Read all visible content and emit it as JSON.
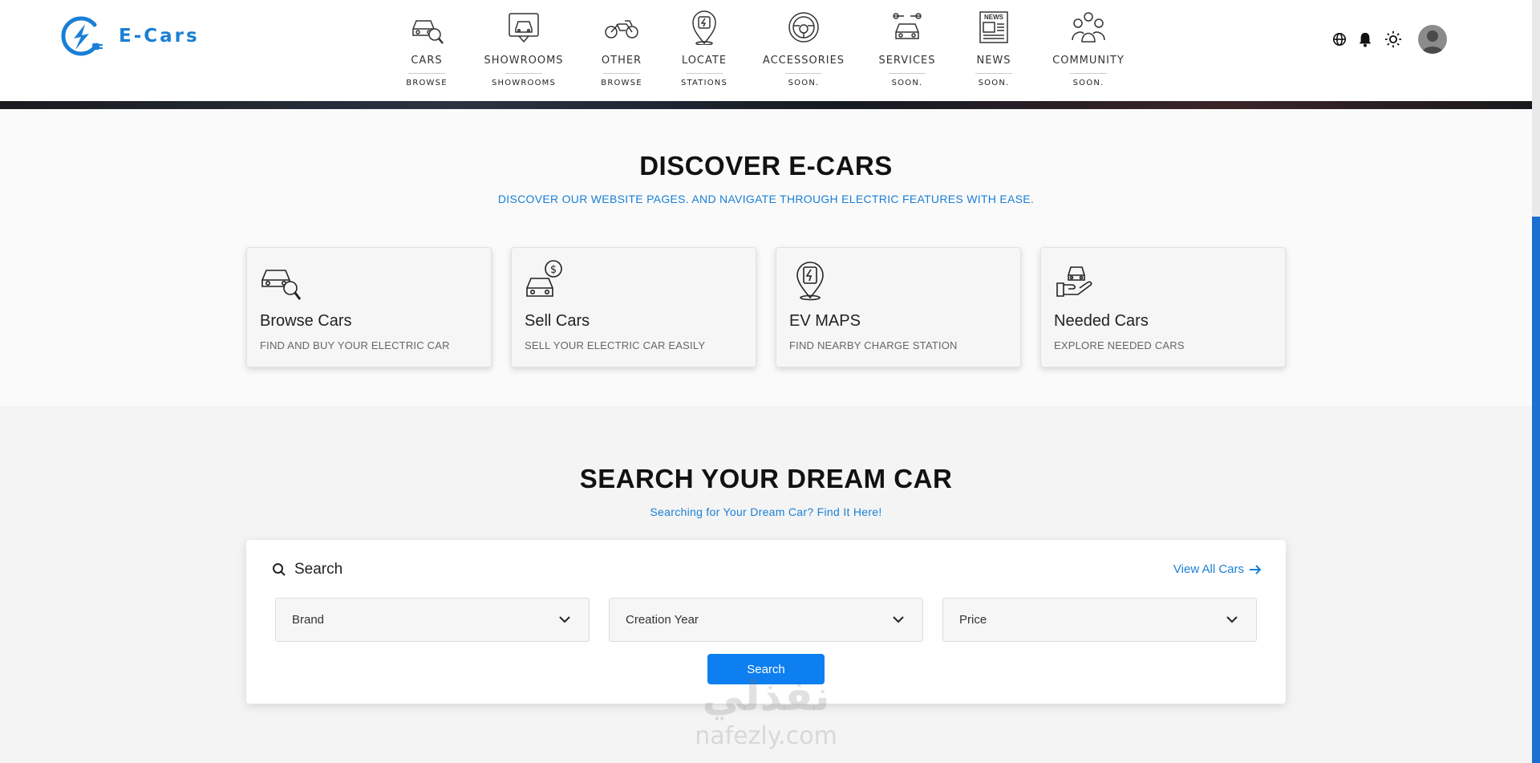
{
  "brand": {
    "name": "E-Cars",
    "color": "#1a7fd6"
  },
  "nav": [
    {
      "label": "CARS",
      "sub": "BROWSE",
      "icon": "car-search-icon"
    },
    {
      "label": "SHOWROOMS",
      "sub": "SHOWROOMS",
      "icon": "showroom-icon"
    },
    {
      "label": "OTHER",
      "sub": "BROWSE",
      "icon": "motorcycle-icon"
    },
    {
      "label": "LOCATE",
      "sub": "STATIONS",
      "icon": "location-pin-icon"
    },
    {
      "label": "ACCESSORIES",
      "sub": "SOON.",
      "icon": "steering-wheel-icon"
    },
    {
      "label": "SERVICES",
      "sub": "SOON.",
      "icon": "car-service-icon"
    },
    {
      "label": "NEWS",
      "sub": "SOON.",
      "icon": "newspaper-icon"
    },
    {
      "label": "COMMUNITY",
      "sub": "SOON.",
      "icon": "community-icon"
    }
  ],
  "header_icons": [
    "globe-icon",
    "bell-icon",
    "sun-icon",
    "avatar"
  ],
  "news_icon_text": "NEWS",
  "discover": {
    "title": "DISCOVER E-CARS",
    "subtitle": "DISCOVER OUR WEBSITE PAGES. AND NAVIGATE THROUGH ELECTRIC FEATURES WITH EASE.",
    "cards": [
      {
        "title": "Browse Cars",
        "desc": "FIND AND BUY YOUR ELECTRIC CAR",
        "icon": "car-search-icon"
      },
      {
        "title": "Sell Cars",
        "desc": "SELL YOUR ELECTRIC CAR EASILY",
        "icon": "car-dollar-icon"
      },
      {
        "title": "EV MAPS",
        "desc": "FIND NEARBY CHARGE STATION",
        "icon": "ev-map-pin-icon"
      },
      {
        "title": "Needed Cars",
        "desc": "EXPLORE NEEDED CARS",
        "icon": "car-hand-icon"
      }
    ]
  },
  "search": {
    "title": "SEARCH YOUR DREAM CAR",
    "subtitle": "Searching for Your Dream Car? Find It Here!",
    "label": "Search",
    "view_all": "View All Cars",
    "filters": [
      "Brand",
      "Creation Year",
      "Price"
    ],
    "button": "Search",
    "button_color": "#0d7ff0"
  },
  "watermark": {
    "arabic": "نفذلي",
    "latin": "nafezly.com"
  }
}
